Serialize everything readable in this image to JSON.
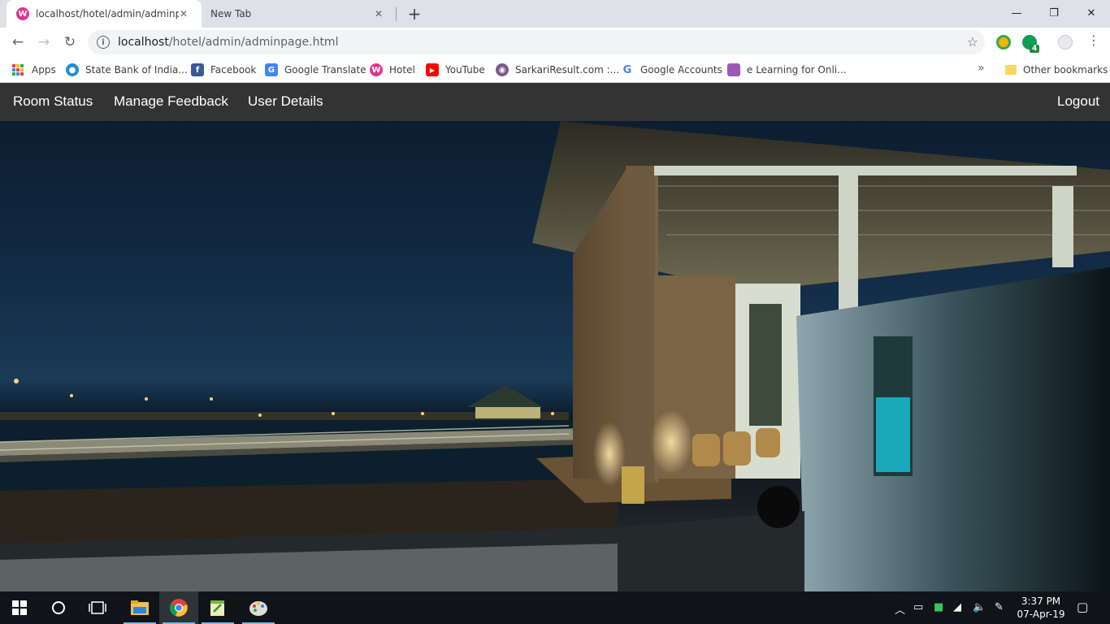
{
  "browser": {
    "tabs": [
      {
        "title": "localhost/hotel/admin/adminpag",
        "favicon": "W"
      },
      {
        "title": "New Tab"
      }
    ],
    "url_host": "localhost",
    "url_path": "/hotel/admin/adminpage.html",
    "extension_badge": "4",
    "bookmarks": [
      {
        "label": "Apps",
        "icon": "apps-grid-icon"
      },
      {
        "label": "State Bank of India...",
        "icon": "sbi-icon",
        "color": "#1e90d6"
      },
      {
        "label": "Facebook",
        "icon": "facebook-icon",
        "color": "#3b5998"
      },
      {
        "label": "Google Translate",
        "icon": "google-translate-icon",
        "color": "#4285f4"
      },
      {
        "label": "Hotel",
        "icon": "hotel-icon",
        "color": "#e0348d"
      },
      {
        "label": "YouTube",
        "icon": "youtube-icon",
        "color": "#ff0000"
      },
      {
        "label": "SarkariResult.com :...",
        "icon": "sarkari-icon",
        "color": "#7a5a8c"
      },
      {
        "label": "Google Accounts",
        "icon": "google-icon",
        "color": "#4285f4"
      },
      {
        "label": "e Learning for Onli...",
        "icon": "elearning-icon",
        "color": "#9b59b6"
      }
    ],
    "other_bookmarks": "Other bookmarks"
  },
  "site": {
    "nav": {
      "room_status": "Room Status",
      "manage_feedback": "Manage Feedback",
      "user_details": "User Details",
      "logout": "Logout"
    },
    "colors": {
      "navbar": "#333333",
      "link": "#ffffff"
    }
  },
  "taskbar": {
    "time": "3:37 PM",
    "date": "07-Apr-19"
  }
}
